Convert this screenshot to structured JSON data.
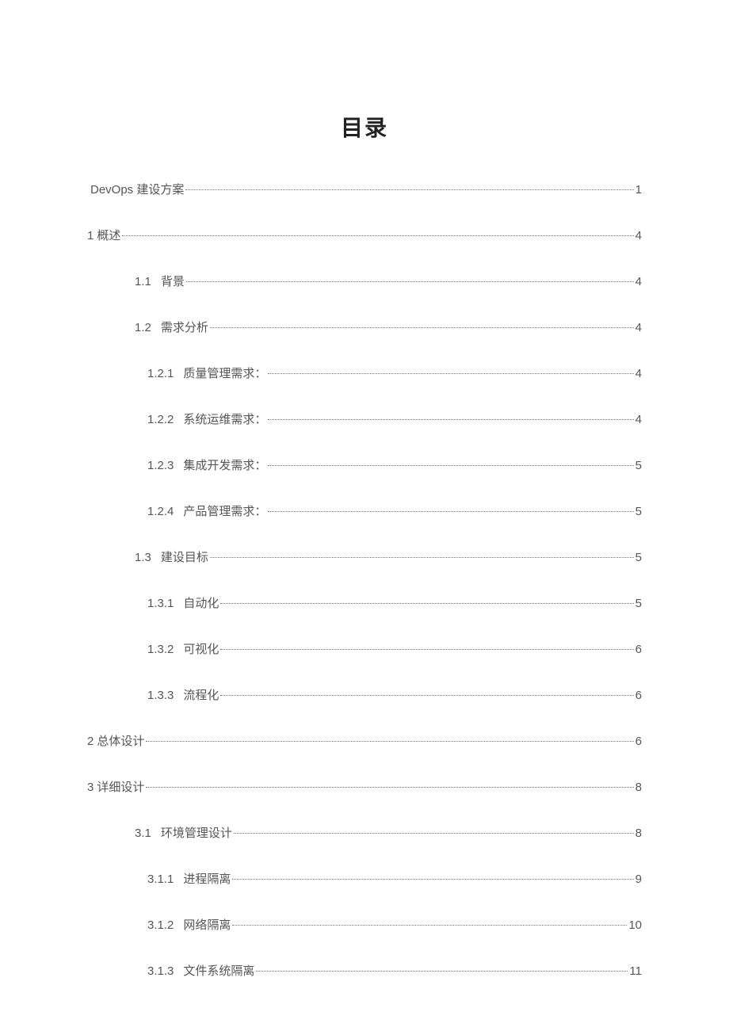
{
  "title": "目录",
  "entries": [
    {
      "level": 0,
      "number": "",
      "label": "DevOps 建设方案",
      "page": "1",
      "spaced": false
    },
    {
      "level": 0,
      "number": "1",
      "label": "概述",
      "page": "4",
      "spaced": false
    },
    {
      "level": 1,
      "number": "1.1",
      "label": "背景",
      "page": "4",
      "spaced": true
    },
    {
      "level": 1,
      "number": "1.2",
      "label": "需求分析",
      "page": "4",
      "spaced": true
    },
    {
      "level": 2,
      "number": "1.2.1",
      "label": "质量管理需求：",
      "page": "4",
      "spaced": true
    },
    {
      "level": 2,
      "number": "1.2.2",
      "label": "系统运维需求：",
      "page": "4",
      "spaced": true
    },
    {
      "level": 2,
      "number": "1.2.3",
      "label": "集成开发需求：",
      "page": "5",
      "spaced": true
    },
    {
      "level": 2,
      "number": "1.2.4",
      "label": "产品管理需求：",
      "page": "5",
      "spaced": true
    },
    {
      "level": 1,
      "number": "1.3",
      "label": "建设目标",
      "page": "5",
      "spaced": true
    },
    {
      "level": 2,
      "number": "1.3.1",
      "label": "自动化",
      "page": "5",
      "spaced": true
    },
    {
      "level": 2,
      "number": "1.3.2",
      "label": "可视化",
      "page": "6",
      "spaced": true
    },
    {
      "level": 2,
      "number": "1.3.3",
      "label": "流程化",
      "page": "6",
      "spaced": true
    },
    {
      "level": 0,
      "number": "2",
      "label": "总体设计",
      "page": "6",
      "spaced": false
    },
    {
      "level": 0,
      "number": "3",
      "label": "详细设计",
      "page": "8",
      "spaced": false
    },
    {
      "level": 1,
      "number": "3.1",
      "label": "环境管理设计",
      "page": "8",
      "spaced": true
    },
    {
      "level": 2,
      "number": "3.1.1",
      "label": "进程隔离",
      "page": "9",
      "spaced": true
    },
    {
      "level": 2,
      "number": "3.1.2",
      "label": "网络隔离",
      "page": "10",
      "spaced": true
    },
    {
      "level": 2,
      "number": "3.1.3",
      "label": "文件系统隔离",
      "page": "11",
      "spaced": true
    }
  ]
}
